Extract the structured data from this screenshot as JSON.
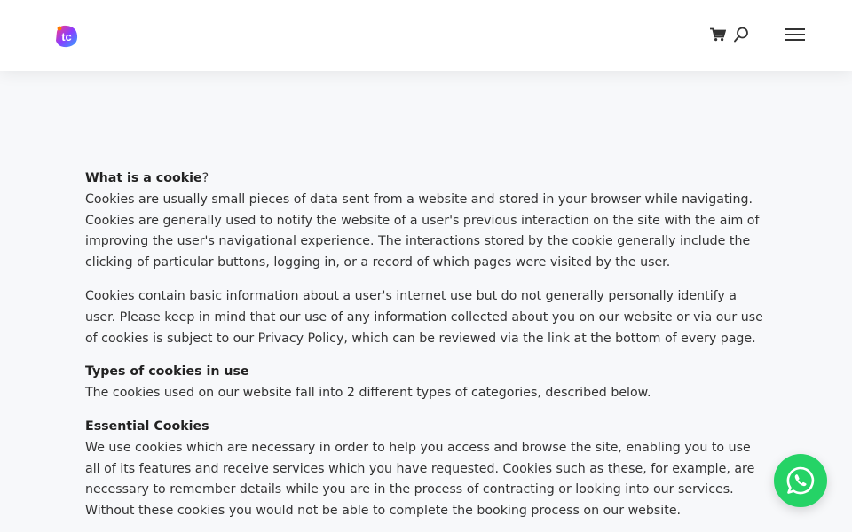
{
  "header": {
    "logo_text": "tc",
    "icons": [
      "cart-icon",
      "search-icon",
      "hamburger-menu-icon"
    ]
  },
  "content": {
    "cookie_heading": "What is a cookie",
    "cookie_heading_suffix": "?",
    "cookie_p1": "Cookies are usually small pieces of data sent from a website and stored in your browser while navigating. Cookies are generally used to notify the website of a user's previous interaction on the site with the aim of improving the user's navigational experience. The interactions stored by the cookie generally include the clicking of particular buttons, logging in, or a record of which pages were visited by the user.",
    "cookie_p2": "Cookies contain basic information about a user's internet use but do not generally personally identify a user. Please keep in mind that our use of any information collected about you on our website or via our use of cookies is subject to our Privacy Policy, which can be reviewed via the link at the bottom of every page.",
    "types_heading": "Types of cookies in use",
    "types_text": "The cookies used on our website fall into 2 different types of categories, described below.",
    "essential_heading": "Essential Cookies",
    "essential_text": "We use cookies which are necessary in order to help you access and browse the site, enabling you to use all of its features and receive services which you have requested. Cookies such as these, for example, are necessary to remember details while you are in the process of contracting or looking into our services. Without these cookies you would not be able to complete the booking process on our website."
  },
  "colors": {
    "whatsapp_green": "#25d366",
    "page_background": "#f7f8fa",
    "header_background": "#ffffff"
  },
  "floating": {
    "icon": "whatsapp-icon"
  }
}
